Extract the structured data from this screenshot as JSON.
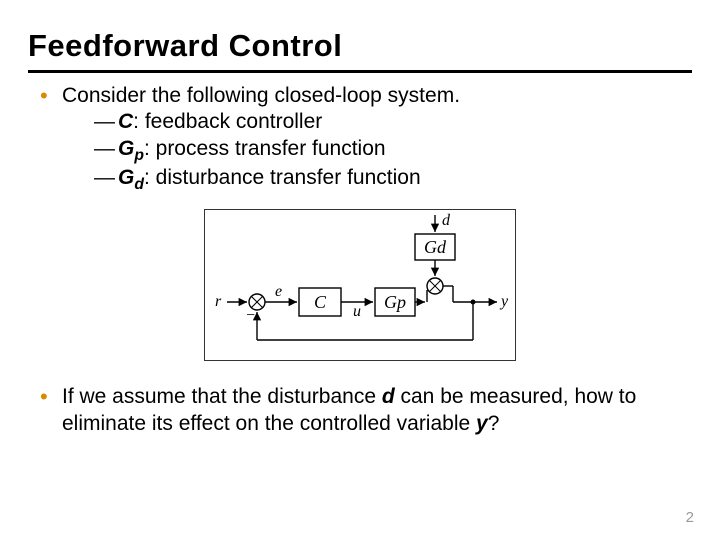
{
  "title": "Feedforward Control",
  "bullet1": {
    "lead": "Consider the following closed-loop system.",
    "defs": [
      {
        "sym": "C",
        "sub": "",
        "desc": ": feedback controller"
      },
      {
        "sym": "G",
        "sub": "p",
        "desc": ": process transfer function"
      },
      {
        "sym": "G",
        "sub": "d",
        "desc": ": disturbance transfer function"
      }
    ]
  },
  "diagram": {
    "signals": {
      "r": "r",
      "e": "e",
      "u": "u",
      "d": "d",
      "y": "y"
    },
    "blocks": {
      "C": "C",
      "Gp": "Gp",
      "Gd": "Gd"
    }
  },
  "bullet2": {
    "pre": "If we assume that the disturbance ",
    "d": "d",
    "mid": " can be measured, how to eliminate its effect on the controlled variable ",
    "y": "y",
    "post": "?"
  },
  "page_number": "2"
}
